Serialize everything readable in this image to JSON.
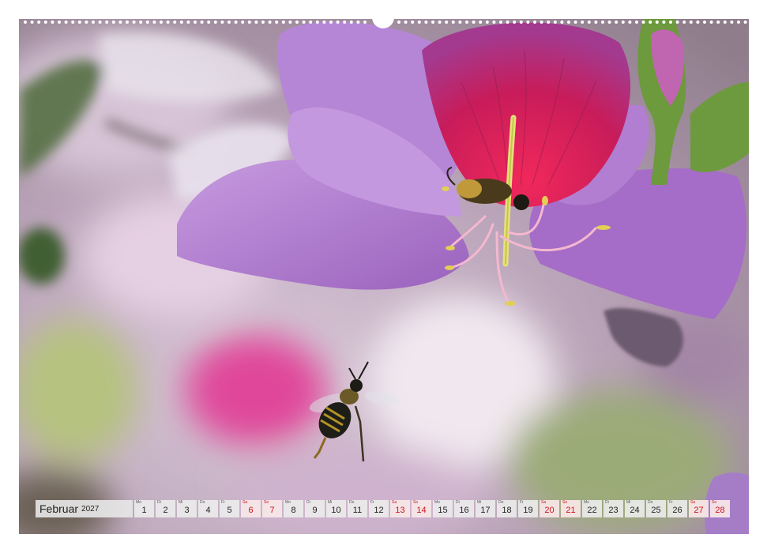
{
  "calendar": {
    "month": "Februar",
    "year": "2027",
    "days": [
      {
        "wd": "Mo",
        "d": "1",
        "we": false
      },
      {
        "wd": "Di",
        "d": "2",
        "we": false
      },
      {
        "wd": "Mi",
        "d": "3",
        "we": false
      },
      {
        "wd": "Do",
        "d": "4",
        "we": false
      },
      {
        "wd": "Fr",
        "d": "5",
        "we": false
      },
      {
        "wd": "Sa",
        "d": "6",
        "we": true
      },
      {
        "wd": "So",
        "d": "7",
        "we": true
      },
      {
        "wd": "Mo",
        "d": "8",
        "we": false
      },
      {
        "wd": "Di",
        "d": "9",
        "we": false
      },
      {
        "wd": "Mi",
        "d": "10",
        "we": false
      },
      {
        "wd": "Do",
        "d": "11",
        "we": false
      },
      {
        "wd": "Fr",
        "d": "12",
        "we": false
      },
      {
        "wd": "Sa",
        "d": "13",
        "we": true
      },
      {
        "wd": "So",
        "d": "14",
        "we": true
      },
      {
        "wd": "Mo",
        "d": "15",
        "we": false
      },
      {
        "wd": "Di",
        "d": "16",
        "we": false
      },
      {
        "wd": "Mi",
        "d": "17",
        "we": false
      },
      {
        "wd": "Do",
        "d": "18",
        "we": false
      },
      {
        "wd": "Fr",
        "d": "19",
        "we": false
      },
      {
        "wd": "Sa",
        "d": "20",
        "we": true
      },
      {
        "wd": "So",
        "d": "21",
        "we": true
      },
      {
        "wd": "Mo",
        "d": "22",
        "we": false
      },
      {
        "wd": "Di",
        "d": "23",
        "we": false
      },
      {
        "wd": "Mi",
        "d": "24",
        "we": false
      },
      {
        "wd": "Do",
        "d": "25",
        "we": false
      },
      {
        "wd": "Fr",
        "d": "26",
        "we": false
      },
      {
        "wd": "Sa",
        "d": "27",
        "we": true
      },
      {
        "wd": "So",
        "d": "28",
        "we": true
      }
    ]
  },
  "colors": {
    "weekend": "#d0121b",
    "weekday": "#222222",
    "petal": "#b07ad0",
    "petal_center": "#d2245a"
  }
}
